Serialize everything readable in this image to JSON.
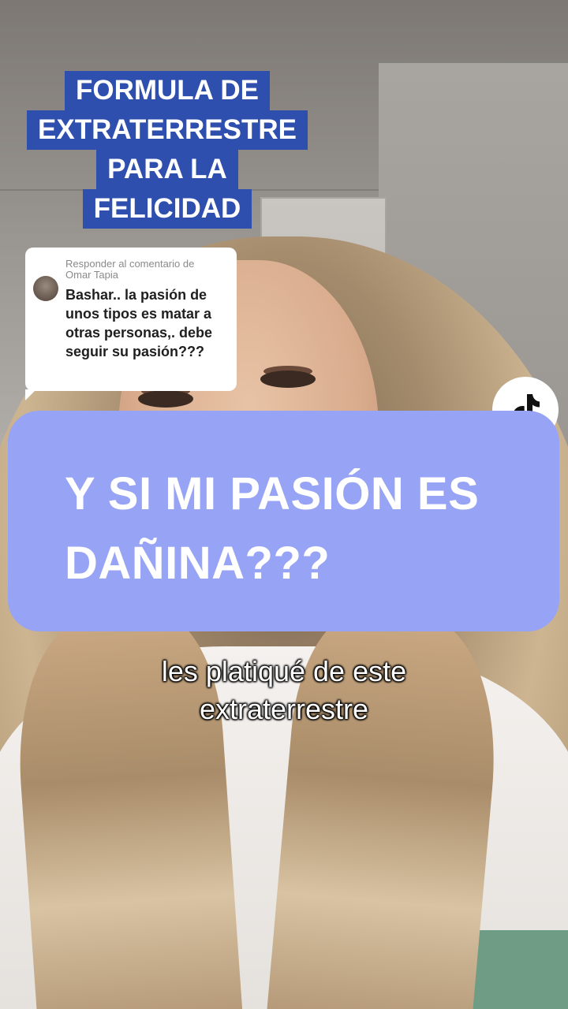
{
  "title_sticker": {
    "lines": [
      "FORMULA DE",
      "EXTRATERRESTRE",
      "PARA LA",
      "FELICIDAD"
    ],
    "background_color": "#2f4fae"
  },
  "reply_comment": {
    "header_line1": "Responder al comentario de",
    "header_line2": "Omar Tapia",
    "text": "Bashar.. la pasión de unos tipos es matar a otras personas,. debe seguir su pasión???"
  },
  "headline": {
    "line1": "Y SI MI PASIÓN ES",
    "line2": "DAÑINA???",
    "background_color": "#97a3f4"
  },
  "caption": {
    "line1": "les platiqué de este",
    "line2": "extraterrestre"
  },
  "icons": {
    "logo": "tiktok-logo-icon",
    "avatar": "commenter-avatar"
  }
}
